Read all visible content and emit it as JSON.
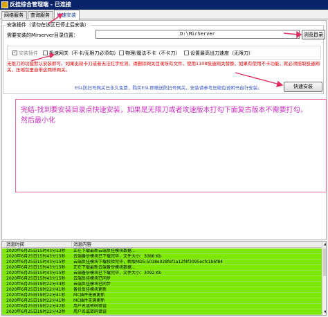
{
  "window": {
    "title": "反挂综合管理端 - 已连接"
  },
  "tabs": [
    {
      "label": "网络服务"
    },
    {
      "label": "查询服务"
    },
    {
      "label": "快速安装"
    }
  ],
  "install": {
    "group_label": "安装插件（请勿在该区已停止后安装）",
    "dir_label": "需要安装的Mirserver目录位置：",
    "dir_value": "D:\\MirServer",
    "browse_label": "浏览目录",
    "options": [
      {
        "label": "安装插件",
        "checked": true,
        "disabled": true
      },
      {
        "label": "极速网关（不卡/无限刀必须勾）",
        "checked": false,
        "disabled": false
      },
      {
        "label": "物理/魔法不卡（不卡刀）",
        "checked": false,
        "disabled": false
      },
      {
        "label": "设置最高出刀速度（无限刀）",
        "checked": false,
        "disabled": false
      }
    ],
    "notice": "无限刀的功能默认安装即可，如果出现卡刀或者无法红字检测，请删除网关目录所有文件，使用1108极速网关替换，如果有使用不卡功能，就必须摇取极速网关，压缩包里自带这两样网关。",
    "esl_text": "ESL防扫号网关已永久免费，购买ESL即赠送防扫号网关，安装请参考压缩包说明书自行安装。",
    "quick_install_label": "快速安装"
  },
  "annotation": {
    "text": "完结-找到要安装目录点快速安装，如果是无限刀或者攻速版本打勾下面复古版本不需要打勾，然后最小化"
  },
  "log": {
    "col_time": "消息时间",
    "col_msg": "消息内容",
    "rows": [
      {
        "time": "2020年6月25日15时43分13秒",
        "msg": "正在下载最新云端反挂模块数据..."
      },
      {
        "time": "2020年6月25日15时43分15秒",
        "msg": "云端备份模块已下载完毕，文件大小：3086 Kb"
      },
      {
        "time": "2020年6月25日15时43分15秒",
        "msg": "云端反挂模块下载校验完毕，新版MD5:5018e028fef1a12f4f3095ecfc1b6f84"
      },
      {
        "time": "2020年6月25日15时43分15秒",
        "msg": "正在下载最新云端备份模块数据..."
      },
      {
        "time": "2020年6月25日15时43分15秒",
        "msg": "云端备份模块已下载完毕，文件大小：3092 Kb"
      },
      {
        "time": "2020年6月25日15时43分15秒",
        "msg": "云端反挂模块已同步"
      },
      {
        "time": "2020年6月25日19时22分34秒",
        "msg": "云端反挂模块已同步"
      },
      {
        "time": "2020年6月25日19时22分41秒",
        "msg": "备份反挂模块更新"
      },
      {
        "time": "2020年6月25日19时22分41秒",
        "msg": "MC插件无需更新"
      },
      {
        "time": "2020年6月25日19时22分41秒",
        "msg": "MC插件无需更新"
      },
      {
        "time": "2020年6月25日19时22分42秒",
        "msg": "用户名或密码错误"
      },
      {
        "time": "2020年6月25日19时22分42秒",
        "msg": "用户名或密码错误"
      }
    ]
  },
  "colors": {
    "title_bg": "#0a246a",
    "log_row_bg": "#7de800",
    "notice": "#e00000",
    "annotation": "#d02ec5",
    "arrow": "#e03060"
  }
}
